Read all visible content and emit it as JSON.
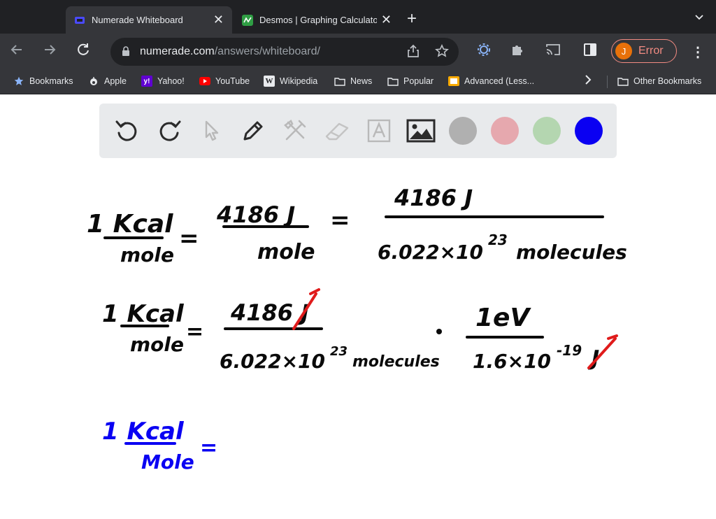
{
  "browser": {
    "tabs": [
      {
        "title": "Numerade Whiteboard",
        "active": true
      },
      {
        "title": "Desmos | Graphing Calculator",
        "active": false
      }
    ],
    "url_host": "numerade.com",
    "url_path": "/answers/whiteboard/",
    "profile_initial": "J",
    "profile_status": "Error"
  },
  "bookmarks": [
    {
      "label": "Bookmarks",
      "icon": "star-icon"
    },
    {
      "label": "Apple",
      "icon": "apple-icon"
    },
    {
      "label": "Yahoo!",
      "icon": "yahoo-icon"
    },
    {
      "label": "YouTube",
      "icon": "youtube-icon"
    },
    {
      "label": "Wikipedia",
      "icon": "wikipedia-icon"
    },
    {
      "label": "News",
      "icon": "folder-icon"
    },
    {
      "label": "Popular",
      "icon": "folder-icon"
    },
    {
      "label": "Advanced (Less...",
      "icon": "bookmark-favicon"
    },
    {
      "label": "Other Bookmarks",
      "icon": "folder-icon"
    }
  ],
  "whiteboard": {
    "tools": [
      "undo-icon",
      "redo-icon",
      "select-pointer-icon",
      "pen-icon",
      "tools-icon",
      "eraser-icon",
      "text-icon",
      "image-icon"
    ],
    "colors": [
      {
        "name": "gray",
        "hex": "#b0b0b0"
      },
      {
        "name": "pink",
        "hex": "#e6a8ae"
      },
      {
        "name": "green",
        "hex": "#b4d6b0"
      },
      {
        "name": "blue",
        "hex": "#0a00f2"
      }
    ],
    "selected_color": "blue",
    "notes": {
      "line1": {
        "lhs_num": "1 Kcal",
        "lhs_den": "mole",
        "mid_num": "4186 J",
        "mid_den": "mole",
        "rhs_num": "4186 J",
        "rhs_den": "6.022×10",
        "rhs_den_exp": "23",
        "rhs_den_unit": "molecules"
      },
      "line2": {
        "lhs_num": "1 Kcal",
        "lhs_den": "mole",
        "f1_num": "4186 J",
        "f1_den": "6.022×10",
        "f1_den_exp": "23",
        "f1_den_unit": "molecules",
        "f2_num": "1eV",
        "f2_den": "1.6×10",
        "f2_den_exp": "-19",
        "f2_den_unit": "J"
      },
      "line3": {
        "lhs_num": "1 Kcal",
        "lhs_den": "Mole"
      }
    }
  }
}
